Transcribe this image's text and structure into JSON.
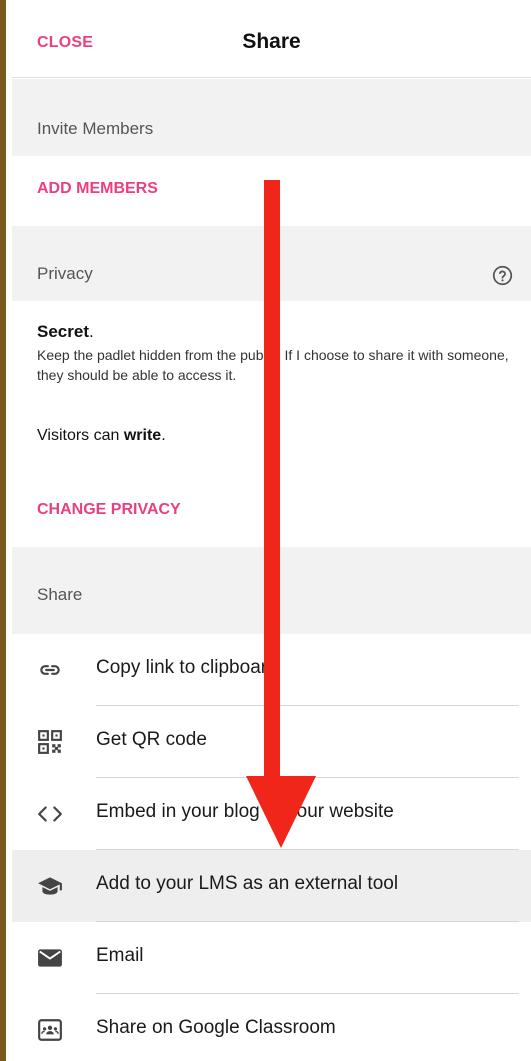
{
  "header": {
    "close_label": "CLOSE",
    "title": "Share"
  },
  "invite": {
    "heading": "Invite Members",
    "add_label": "ADD MEMBERS"
  },
  "privacy": {
    "heading": "Privacy",
    "level": "Secret",
    "level_suffix": ".",
    "description": "Keep the padlet hidden from the public. If I choose to share it with someone, they should be able to access it.",
    "visitors_prefix": "Visitors can ",
    "visitors_permission": "write",
    "visitors_suffix": ".",
    "change_label": "CHANGE PRIVACY",
    "help_icon": "question-circle-icon"
  },
  "share": {
    "heading": "Share",
    "items": [
      {
        "label": "Copy link to clipboard",
        "icon": "link-icon"
      },
      {
        "label": "Get QR code",
        "icon": "qr-code-icon"
      },
      {
        "label": "Embed in your blog or your website",
        "icon": "code-brackets-icon"
      },
      {
        "label": "Add to your LMS as an external tool",
        "icon": "graduation-cap-icon"
      },
      {
        "label": "Email",
        "icon": "envelope-icon"
      },
      {
        "label": "Share on Google Classroom",
        "icon": "google-classroom-icon"
      }
    ]
  },
  "colors": {
    "accent": "#ec3f83",
    "arrow": "#f0261b",
    "left_border": "#7a5a1c",
    "section_bg": "#f2f2f2"
  },
  "annotation": {
    "type": "arrow",
    "direction": "down"
  }
}
